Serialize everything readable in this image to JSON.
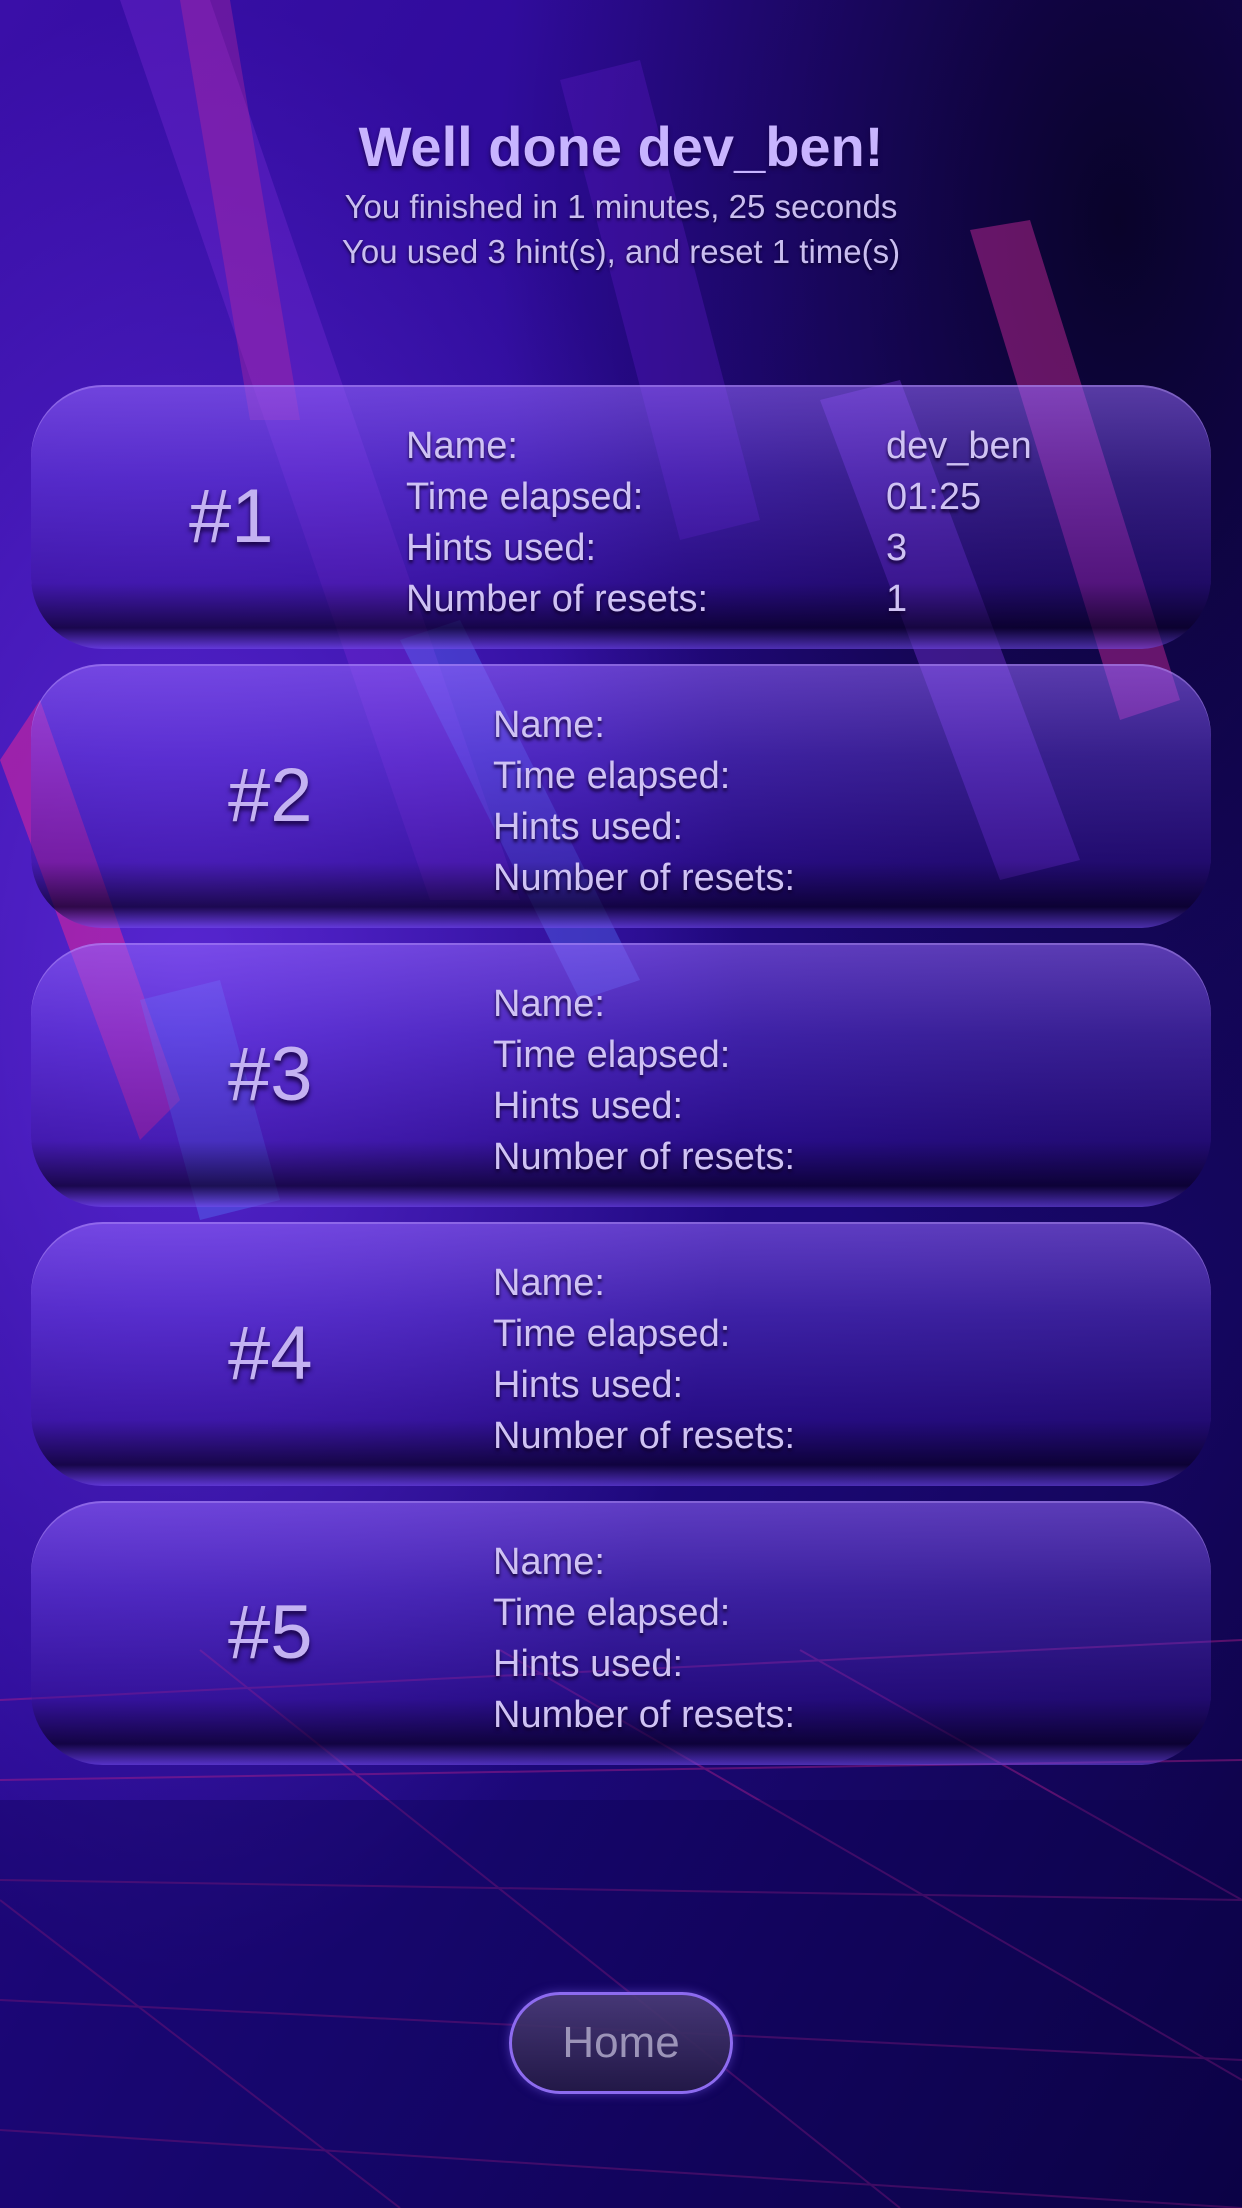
{
  "header": {
    "title": "Well done dev_ben!",
    "line1": "You finished in 1 minutes, 25 seconds",
    "line2": "You used 3 hint(s), and reset 1 time(s)"
  },
  "labels": {
    "name": "Name:",
    "time": "Time elapsed:",
    "hints": "Hints used:",
    "resets": "Number of resets:"
  },
  "leaderboard": [
    {
      "rank": "#1",
      "name": "dev_ben",
      "time": "01:25",
      "hints": "3",
      "resets": "1"
    },
    {
      "rank": "#2",
      "name": "",
      "time": "",
      "hints": "",
      "resets": ""
    },
    {
      "rank": "#3",
      "name": "",
      "time": "",
      "hints": "",
      "resets": ""
    },
    {
      "rank": "#4",
      "name": "",
      "time": "",
      "hints": "",
      "resets": ""
    },
    {
      "rank": "#5",
      "name": "",
      "time": "",
      "hints": "",
      "resets": ""
    }
  ],
  "home_button": {
    "label": "Home"
  },
  "colors": {
    "accent": "#8d6bf0",
    "title": "#c8b4ff",
    "background": "#14063f"
  }
}
